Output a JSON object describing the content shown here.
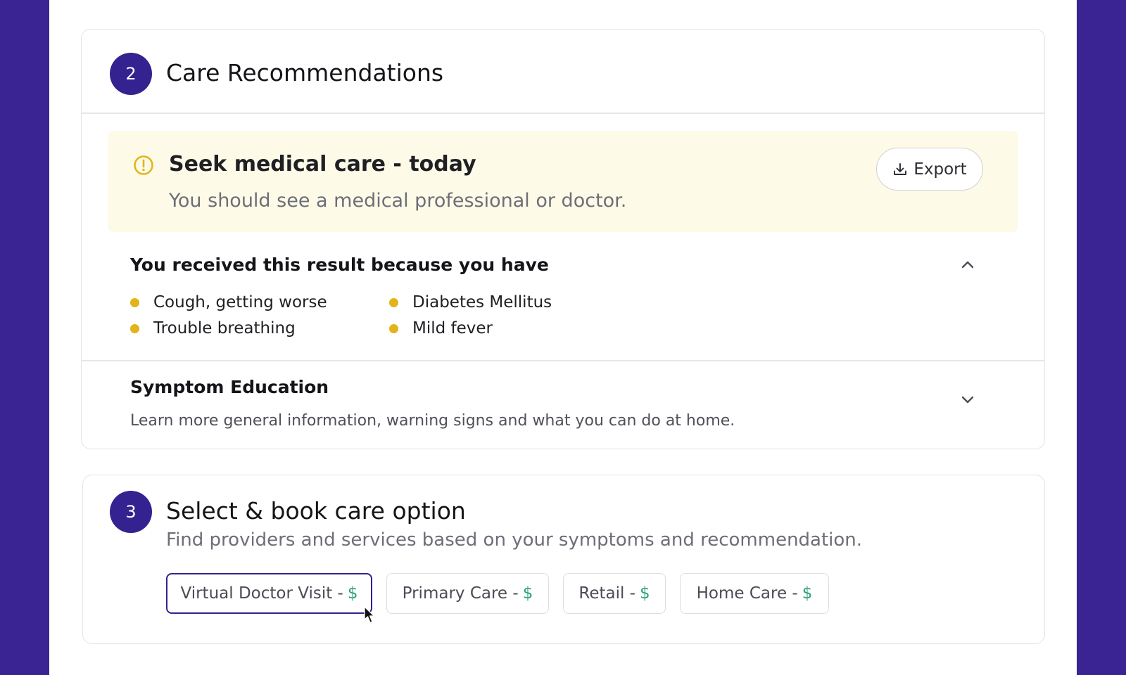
{
  "care": {
    "step": "2",
    "title": "Care Recommendations",
    "alert": {
      "icon": "exclamation-circle-icon",
      "title": "Seek medical care - today",
      "subtitle": "You should see a medical professional or doctor.",
      "export_label": "Export"
    },
    "reasons": {
      "heading": "You received this result because you have",
      "items": [
        "Cough, getting worse",
        "Trouble breathing",
        "Diabetes Mellitus",
        "Mild fever"
      ]
    },
    "education": {
      "heading": "Symptom Education",
      "text": "Learn more general information, warning signs and what you can do at home."
    }
  },
  "booking": {
    "step": "3",
    "title": "Select & book care option",
    "subtitle": "Find providers and services based on your symptoms and recommendation.",
    "options": [
      {
        "label": "Virtual Doctor Visit -",
        "price": "$",
        "selected": true
      },
      {
        "label": "Primary Care -",
        "price": "$",
        "selected": false
      },
      {
        "label": "Retail -",
        "price": "$",
        "selected": false
      },
      {
        "label": "Home Care -",
        "price": "$",
        "selected": false
      }
    ]
  },
  "colors": {
    "background": "#3a2494",
    "accent": "#33228f",
    "warning": "#e2b418",
    "alert_bg": "#fdfbe8",
    "price": "#2fa277"
  }
}
